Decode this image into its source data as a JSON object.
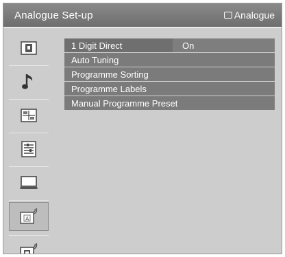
{
  "header": {
    "title": "Analogue Set-up",
    "source_icon": "input-source-icon",
    "source_label": "Analogue"
  },
  "sidebar": {
    "items": [
      {
        "icon": "picture-icon",
        "selected": false
      },
      {
        "icon": "music-note-icon",
        "selected": false
      },
      {
        "icon": "screen-layout-icon",
        "selected": false
      },
      {
        "icon": "settings-list-icon",
        "selected": false
      },
      {
        "icon": "monitor-icon",
        "selected": false
      },
      {
        "icon": "analogue-antenna-icon",
        "selected": true
      },
      {
        "icon": "digital-antenna-icon",
        "selected": false
      }
    ]
  },
  "menu": {
    "items": [
      {
        "label": "1 Digit Direct",
        "value": "On"
      },
      {
        "label": "Auto Tuning"
      },
      {
        "label": "Programme Sorting"
      },
      {
        "label": "Programme Labels"
      },
      {
        "label": "Manual Programme Preset"
      }
    ]
  },
  "colors": {
    "background": "#cdcdcd",
    "title_bar": "#7a7a7a",
    "menu_row": "#7b7b7b",
    "text": "#ffffff"
  }
}
